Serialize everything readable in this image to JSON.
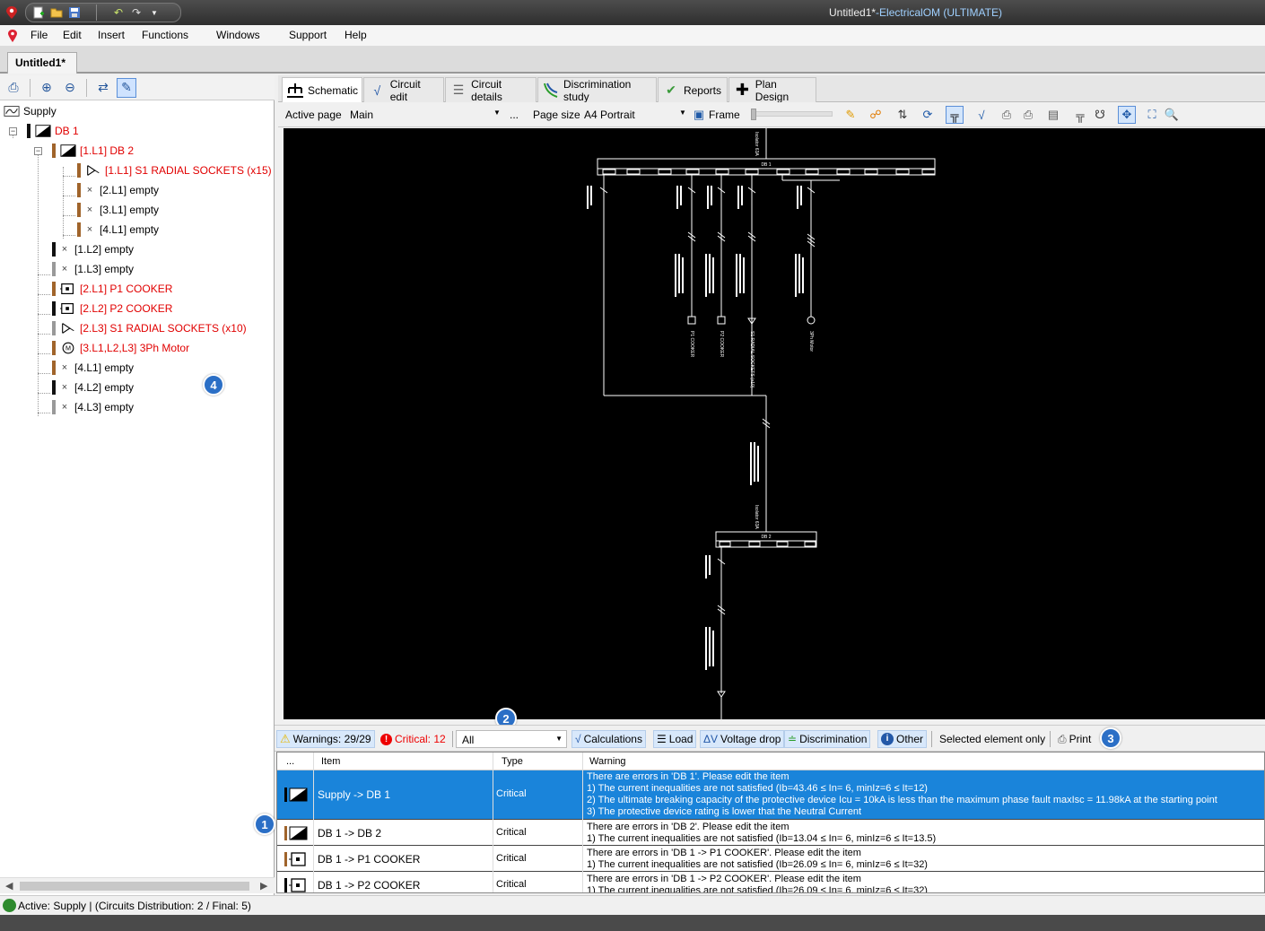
{
  "window": {
    "title_doc": "Untitled1*",
    "title_app": "-ElectricalOM",
    "title_edition": "(ULTIMATE)"
  },
  "quick_access": [
    "new-icon",
    "open-folder-icon",
    "save-icon",
    "undo-icon",
    "redo-icon",
    "dropdown-icon"
  ],
  "menu": [
    "File",
    "Edit",
    "Insert",
    "Functions",
    "Windows",
    "Support",
    "Help"
  ],
  "document_tab": "Untitled1*",
  "tree": {
    "root": "Supply",
    "nodes": [
      {
        "label": "DB 1",
        "error": true
      },
      {
        "label": "[1.L1] DB 2",
        "error": true
      },
      {
        "label": "[1.L1] S1 RADIAL SOCKETS (x15)",
        "error": true
      },
      {
        "label": "[2.L1] empty",
        "error": false
      },
      {
        "label": "[3.L1] empty",
        "error": false
      },
      {
        "label": "[4.L1] empty",
        "error": false
      },
      {
        "label": "[1.L2] empty",
        "error": false
      },
      {
        "label": "[1.L3] empty",
        "error": false
      },
      {
        "label": "[2.L1] P1 COOKER",
        "error": true
      },
      {
        "label": "[2.L2] P2 COOKER",
        "error": true
      },
      {
        "label": "[2.L3] S1 RADIAL SOCKETS (x10)",
        "error": true
      },
      {
        "label": "[3.L1,L2,L3] 3Ph Motor",
        "error": true
      },
      {
        "label": "[4.L1] empty",
        "error": false
      },
      {
        "label": "[4.L2] empty",
        "error": false
      },
      {
        "label": "[4.L3] empty",
        "error": false
      }
    ]
  },
  "main_tabs": [
    {
      "label": "Schematic",
      "icon": "schematic-icon"
    },
    {
      "label": "Circuit edit",
      "icon": "circuit-edit-icon"
    },
    {
      "label": "Circuit details",
      "icon": "circuit-details-icon"
    },
    {
      "label": "Discrimination study",
      "icon": "discrimination-icon"
    },
    {
      "label": "Reports",
      "icon": "reports-icon"
    },
    {
      "label": "Plan Design",
      "icon": "plan-design-icon"
    }
  ],
  "schematic_toolbar": {
    "active_page_label": "Active page",
    "active_page_value": "Main",
    "more": "...",
    "page_size_label": "Page size",
    "page_size_value": "A4 Portrait",
    "frame_label": "Frame"
  },
  "schematic": {
    "db1_label": "DB 1",
    "db2_label": "DB 2",
    "isolator_label": "Isolator 63A",
    "circuit_labels": [
      "P1 COOKER",
      "P2 COOKER",
      "S1 RADIAL SOCKETS (x10)",
      "3Ph Motor"
    ]
  },
  "warnings_bar": {
    "warnings": "Warnings: 29/29",
    "critical": "Critical: 12",
    "filter": "All",
    "buttons": [
      "Calculations",
      "Load",
      "Voltage drop",
      "Discrimination",
      "Other"
    ],
    "selected_only": "Selected element only",
    "print": "Print"
  },
  "grid": {
    "headers": [
      "...",
      "Item",
      "Type",
      "Warning"
    ],
    "rows": [
      {
        "item": "Supply -> DB 1",
        "type": "Critical",
        "selected": true,
        "lines": [
          "There are errors in 'DB 1'. Please edit the item",
          "1) The current inequalities are not satisfied (Ib=43.46 ≤ In= 6, minIz=6 ≤ It=12)",
          "2) The ultimate breaking capacity of the protective device Icu = 10kA is less than the maximum phase fault maxIsc = 11.98kA at the starting point",
          "3) The protective device rating is lower that the Neutral Current"
        ]
      },
      {
        "item": "DB 1 -> DB 2",
        "type": "Critical",
        "selected": false,
        "lines": [
          "There are errors in 'DB 2'. Please edit the item",
          "1) The current inequalities are not satisfied (Ib=13.04 ≤ In= 6, minIz=6 ≤ It=13.5)"
        ]
      },
      {
        "item": "DB 1 -> P1 COOKER",
        "type": "Critical",
        "selected": false,
        "lines": [
          "There are errors in 'DB 1 -> P1 COOKER'. Please edit the item",
          "1) The current inequalities are not satisfied (Ib=26.09 ≤ In= 6, minIz=6 ≤ It=32)"
        ]
      },
      {
        "item": "DB 1 -> P2 COOKER",
        "type": "Critical",
        "selected": false,
        "lines": [
          "There are errors in 'DB 1 -> P2 COOKER'. Please edit the item",
          "1) The current inequalities are not satisfied (Ib=26.09 ≤ In= 6, minIz=6 ≤ It=32)"
        ]
      }
    ]
  },
  "status": "Active: Supply | (Circuits Distribution: 2 / Final: 5)",
  "callouts": [
    "1",
    "2",
    "3",
    "4"
  ],
  "colors": {
    "error_text": "#e10000",
    "selection": "#1a84da",
    "callout": "#2b6fc6"
  }
}
